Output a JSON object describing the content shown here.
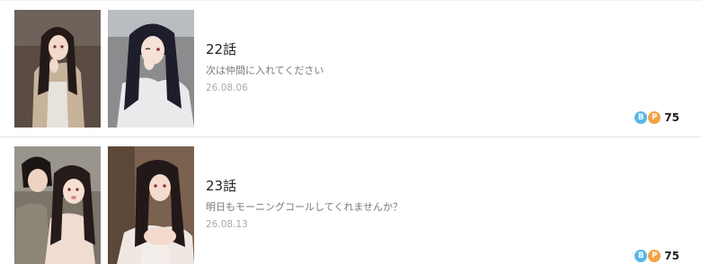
{
  "episodes": [
    {
      "title": "22話",
      "description": "次は仲間に入れてください",
      "date": "26.08.06",
      "price": "75",
      "coins": {
        "b": "B",
        "p": "P"
      },
      "thumbnails": [
        "manga-panel-image",
        "manga-panel-image"
      ]
    },
    {
      "title": "23話",
      "description": "明日もモーニングコールしてくれませんか？",
      "date": "26.08.13",
      "price": "75",
      "coins": {
        "b": "B",
        "p": "P"
      },
      "thumbnails": [
        "manga-panel-image",
        "manga-panel-image"
      ]
    }
  ],
  "colors": {
    "coin_b": "#5ab7e6",
    "coin_p": "#f2a445",
    "title": "#222222",
    "desc": "#7a7a7a",
    "date": "#a9a9a9"
  }
}
